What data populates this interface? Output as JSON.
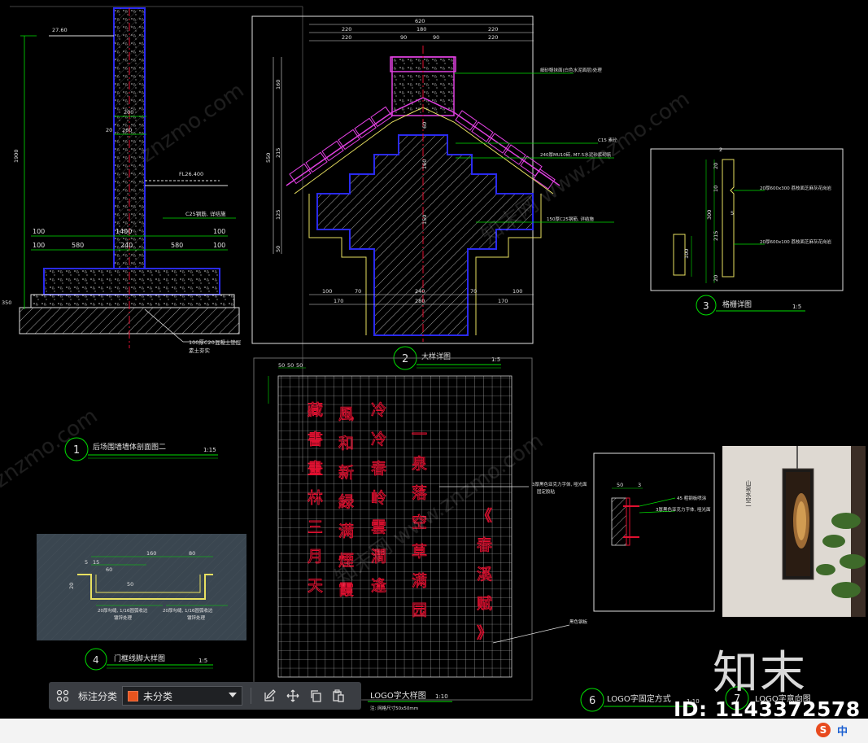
{
  "drawing": {
    "titles": {
      "t1_num": "1",
      "t1": "后场围墙墙体剖面图二",
      "t1_scale": "1:15",
      "t2_num": "2",
      "t2": "大样详图",
      "t2_scale": "1:5",
      "t3_num": "3",
      "t3": "格栅详图",
      "t3_scale": "1:5",
      "t4_num": "4",
      "t4": "门框线脚大样图",
      "t4_scale": "1:5",
      "t5": "LOGO字大样图",
      "t5_scale": "1:10",
      "t5_note": "注: 网格尺寸50x50mm",
      "t6_num": "6",
      "t6": "LOGO字固定方式",
      "t6_scale": "1:10",
      "t7_num": "7",
      "t7": "LOGO字意向图"
    },
    "d1": {
      "elev_top": "27.60",
      "elev_mid": "FL26.400",
      "h_total": "1900",
      "w_wall": "200",
      "w_260": "260",
      "w_20": "20",
      "w1400": "1400",
      "w100a": "100",
      "w580a": "580",
      "w240": "240",
      "w580b": "580",
      "w100b": "100",
      "note_c25": "C25钢筋, 详结施",
      "note_base": "100厚C20混凝土垫层",
      "note_base2": "素土夯实",
      "h350": "350"
    },
    "d2": {
      "top620": "620",
      "d220a": "220",
      "d180": "180",
      "d220b": "220",
      "d220c": "220",
      "d90a": "90",
      "d90b": "90",
      "d220d": "220",
      "h550": "550",
      "h160": "160",
      "h215": "215",
      "h125": "125",
      "h50": "50",
      "b100": "100",
      "b70a": "70",
      "b240": "240",
      "b70b": "70",
      "b100b": "100",
      "b170a": "170",
      "b280": "280",
      "b170b": "170",
      "note1": "細砂漿抹面(白色水泥面层)处理",
      "note2": "C15 素砼",
      "note3": "240厚MU10砖, M7.5水泥砂浆砌筑",
      "note4": "150厚C25钢筋, 详结施",
      "v60": "60",
      "v160": "160",
      "v150": "150"
    },
    "d3": {
      "h2": "2",
      "h20": "20",
      "h10": "10",
      "h300": "300",
      "h215": "215",
      "h20b": "20",
      "h100": "100",
      "h5": "5",
      "note1": "20厚600x300 荔枝面芝麻灰花岗岩",
      "note2": "20厚600x100 荔枝面芝麻灰花岗岩"
    },
    "d4": {
      "w160": "160",
      "w80": "80",
      "w5": "5",
      "w15": "15",
      "w60": "60",
      "w20": "20",
      "w50": "50",
      "note1": "20厚勾缝, 1/16圆弧收边",
      "note2": "20厚勾缝, 1/16圆弧收边",
      "note3": "镀锌处理",
      "note4": "镀锌处理"
    },
    "d5": {
      "grid_labels": [
        "50",
        "50",
        "50"
      ],
      "callout1": "3厚黑色亚克力字体, 哑光面",
      "callout1b": "固定胶粘",
      "callout2": "黑色钢板"
    },
    "d6": {
      "dim50": "50",
      "dim3": "3",
      "note1": "45 粗钢板喷涂",
      "note2": "3厚黑色亚克力字体, 哑光面"
    },
    "logo_chars": {
      "col1": [
        "藏",
        "書",
        "畫",
        "林",
        "三",
        "月",
        "天"
      ],
      "col2": [
        "風",
        "和",
        "新",
        "緑",
        "满",
        "煙",
        "霞"
      ],
      "col3": [
        "冷",
        "冷",
        "春",
        "岭",
        "雲",
        "澗",
        "逢"
      ],
      "col4": [
        "一",
        "泉",
        "落",
        "空",
        "草",
        "满",
        "园"
      ],
      "col5": [
        "《",
        "春",
        "溪",
        "赋",
        "》"
      ]
    },
    "watermarks": [
      "znzmo.com",
      "知末网 www.znzmo.com"
    ]
  },
  "toolbar": {
    "label": "标注分类",
    "selected": "未分类",
    "icons": [
      "grid-icon",
      "edit-icon",
      "move-icon",
      "copy-icon",
      "paste-icon"
    ]
  },
  "brand": "知末",
  "id_text": "ID: 1143372578",
  "ime": {
    "zh": "中"
  },
  "colors": {
    "bg": "#000000",
    "green": "#00e000",
    "blue": "#2a2af0",
    "magenta": "#e040e0",
    "red": "#e01030",
    "yellow": "#e8e060"
  }
}
